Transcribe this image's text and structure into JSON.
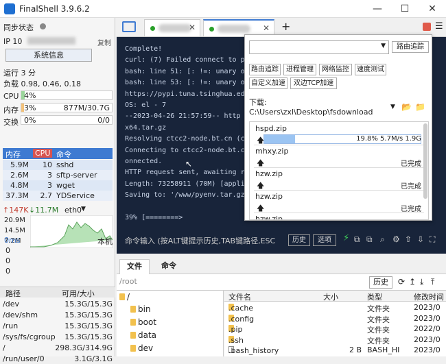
{
  "window": {
    "title": "FinalShell 3.9.6.2",
    "min": "—",
    "max": "☐",
    "close": "✕"
  },
  "left": {
    "sync_label": "同步状态",
    "ip_label": "IP 10",
    "copy_label": "复制",
    "sysinfo_btn": "系统信息",
    "uptime": "运行 3 分",
    "load": "负载 0.98, 0.46, 0.18",
    "cpu_label": "CPU",
    "cpu_pct": "4%",
    "cpu_value": 0.04,
    "mem_label": "内存",
    "mem_pct": "3%",
    "mem_value": 0.03,
    "mem_size": "877M/30.7G",
    "swap_label": "交换",
    "swap_pct": "0%",
    "swap_value": 0,
    "swap_size": "0/0",
    "proc_headers": [
      "内存",
      "CPU",
      "命令"
    ],
    "procs": [
      {
        "mem": "5.9M",
        "cpu": "10",
        "cmd": "sshd"
      },
      {
        "mem": "2.6M",
        "cpu": "3",
        "cmd": "sftp-server"
      },
      {
        "mem": "4.8M",
        "cpu": "3",
        "cmd": "wget"
      },
      {
        "mem": "37.3M",
        "cpu": "2.7",
        "cmd": "YDService"
      }
    ],
    "net_up": "↑147K",
    "net_down": "↓11.7M",
    "net_iface": "eth0",
    "net_y": [
      "20.9M",
      "14.5M",
      "7.2M"
    ],
    "ping_label": "0ms",
    "ping_host": "本机",
    "ping_y": [
      "0",
      "0",
      "0"
    ],
    "disk_headers": [
      "路径",
      "可用/大小"
    ],
    "disks": [
      {
        "path": "/dev",
        "size": "15.3G/15.3G"
      },
      {
        "path": "/dev/shm",
        "size": "15.3G/15.3G"
      },
      {
        "path": "/run",
        "size": "15.3G/15.3G"
      },
      {
        "path": "/sys/fs/cgroup",
        "size": "15.3G/15.3G"
      },
      {
        "path": "/",
        "size": "298.3G/314.9G"
      },
      {
        "path": "/run/user/0",
        "size": "3.1G/3.1G"
      }
    ]
  },
  "tabs": {
    "add": "+"
  },
  "terminal": {
    "lines": [
      "Complete!",
      "curl: (7) Failed connect to p",
      "bash: line 51: [: !=: unary o",
      "bash: line 53: [: !=: unary o",
      "https://pypi.tuna.tsinghua.ed",
      "OS: el - 7",
      "--2023-04-26 21:57:59--  http",
      "x64.tar.gz",
      "Resolving ctcc2-node.bt.cn (c",
      "Connecting to ctcc2-node.bt.c",
      "onnected.",
      "HTTP request sent, awaiting r",
      "Length: 73258911 (70M) [appli",
      "Saving to: '/www/pyenv.tar.gz",
      "",
      "39% [========>"
    ],
    "cmd_placeholder": "命令输入 (按ALT键提示历史,TAB键路径,ESC",
    "history_btn": "历史",
    "options_btn": "选项"
  },
  "popup": {
    "route_btn": "路由追踪",
    "tools": [
      "路由追踪",
      "进程管理",
      "网络监控",
      "速度测试",
      "自定义加速",
      "双边TCP加速"
    ],
    "download_label": "下载: C:\\Users\\zxl\\Desktop\\fsdownload",
    "downloads": [
      {
        "name": "hspd.zip",
        "status": "19.8% 5.7M/s 1.9G",
        "progress": 0.198
      },
      {
        "name": "mhxy.zip",
        "status": "已完成",
        "progress": 1
      },
      {
        "name": "hzw.zip",
        "status": "已完成",
        "progress": 1
      },
      {
        "name": "hzw.zip",
        "status": "已完成",
        "progress": 1
      },
      {
        "name": "hzw.zip",
        "status": "",
        "progress": 1
      }
    ]
  },
  "fm": {
    "tab_files": "文件",
    "tab_cmd": "命令",
    "path": "/root",
    "history_btn": "历史",
    "tree_root": "/",
    "tree": [
      "bin",
      "boot",
      "data",
      "dev"
    ],
    "headers": [
      "文件名",
      "大小",
      "类型",
      "修改时间"
    ],
    "files": [
      {
        "name": ".cache",
        "size": "",
        "type": "文件夹",
        "date": "2023/0"
      },
      {
        "name": ".config",
        "size": "",
        "type": "文件夹",
        "date": "2023/0"
      },
      {
        "name": ".pip",
        "size": "",
        "type": "文件夹",
        "date": "2022/0"
      },
      {
        "name": ".ssh",
        "size": "",
        "type": "文件夹",
        "date": "2023/0"
      },
      {
        "name": ".bash_history",
        "size": "2 B",
        "type": "BASH_HI",
        "date": "2023/0"
      }
    ]
  }
}
